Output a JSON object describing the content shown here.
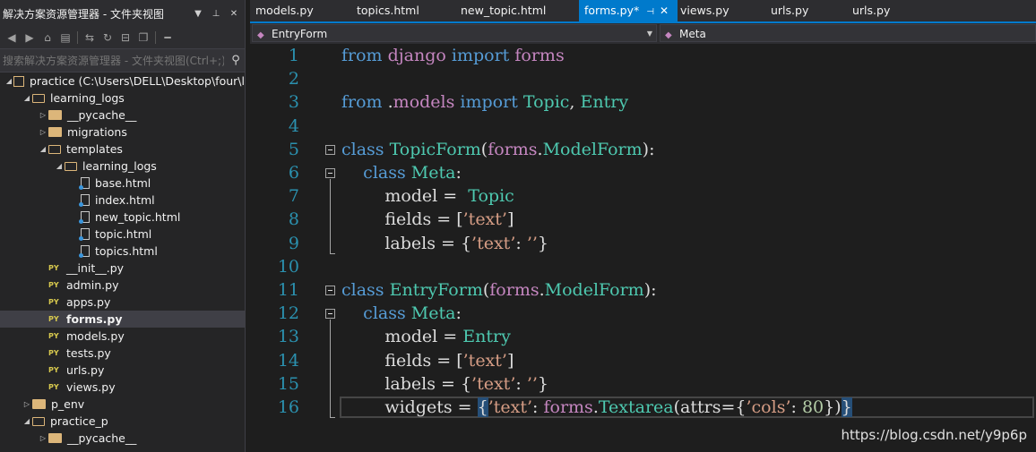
{
  "solution_explorer": {
    "title": "解决方案资源管理器 - 文件夹视图",
    "search_placeholder": "搜索解决方案资源管理器 - 文件夹视图(Ctrl+;)",
    "tree": [
      {
        "label": "practice (C:\\Users\\DELL\\Desktop\\four\\l",
        "level": 0,
        "type": "project",
        "expanded": true
      },
      {
        "label": "learning_logs",
        "level": 1,
        "type": "folder",
        "expanded": true
      },
      {
        "label": "__pycache__",
        "level": 2,
        "type": "folder",
        "expanded": false
      },
      {
        "label": "migrations",
        "level": 2,
        "type": "folder",
        "expanded": false
      },
      {
        "label": "templates",
        "level": 2,
        "type": "folder",
        "expanded": true
      },
      {
        "label": "learning_logs",
        "level": 3,
        "type": "folder",
        "expanded": true
      },
      {
        "label": "base.html",
        "level": 4,
        "type": "html"
      },
      {
        "label": "index.html",
        "level": 4,
        "type": "html"
      },
      {
        "label": "new_topic.html",
        "level": 4,
        "type": "html"
      },
      {
        "label": "topic.html",
        "level": 4,
        "type": "html"
      },
      {
        "label": "topics.html",
        "level": 4,
        "type": "html"
      },
      {
        "label": "__init__.py",
        "level": 2,
        "type": "py"
      },
      {
        "label": "admin.py",
        "level": 2,
        "type": "py"
      },
      {
        "label": "apps.py",
        "level": 2,
        "type": "py"
      },
      {
        "label": "forms.py",
        "level": 2,
        "type": "py",
        "selected": true
      },
      {
        "label": "models.py",
        "level": 2,
        "type": "py"
      },
      {
        "label": "tests.py",
        "level": 2,
        "type": "py"
      },
      {
        "label": "urls.py",
        "level": 2,
        "type": "py"
      },
      {
        "label": "views.py",
        "level": 2,
        "type": "py"
      },
      {
        "label": "p_env",
        "level": 1,
        "type": "folder",
        "expanded": false
      },
      {
        "label": "practice_p",
        "level": 1,
        "type": "folder",
        "expanded": true
      },
      {
        "label": "__pycache__",
        "level": 2,
        "type": "folder",
        "expanded": false
      }
    ]
  },
  "tabs": [
    {
      "label": "models.py",
      "active": false
    },
    {
      "label": "topics.html",
      "active": false
    },
    {
      "label": "new_topic.html",
      "active": false
    },
    {
      "label": "forms.py*",
      "active": true
    },
    {
      "label": "views.py",
      "active": false
    },
    {
      "label": "urls.py",
      "active": false
    },
    {
      "label": "urls.py",
      "active": false
    }
  ],
  "navbar": {
    "class_combo": "EntryForm",
    "member_combo": "Meta"
  },
  "editor": {
    "line_numbers": [
      "1",
      "2",
      "3",
      "4",
      "5",
      "6",
      "7",
      "8",
      "9",
      "10",
      "11",
      "12",
      "13",
      "14",
      "15",
      "16"
    ],
    "lines": [
      [
        [
          "kw",
          "from"
        ],
        [
          "p",
          " "
        ],
        [
          "mod",
          "django"
        ],
        [
          "p",
          " "
        ],
        [
          "kw",
          "import"
        ],
        [
          "p",
          " "
        ],
        [
          "mod",
          "forms"
        ]
      ],
      [],
      [
        [
          "kw",
          "from"
        ],
        [
          "p",
          " ."
        ],
        [
          "mod",
          "models"
        ],
        [
          "p",
          " "
        ],
        [
          "kw",
          "import"
        ],
        [
          "p",
          " "
        ],
        [
          "cls",
          "Topic"
        ],
        [
          "p",
          ", "
        ],
        [
          "cls",
          "Entry"
        ]
      ],
      [],
      [
        [
          "kw",
          "class"
        ],
        [
          "p",
          " "
        ],
        [
          "cls",
          "TopicForm"
        ],
        [
          "p",
          "("
        ],
        [
          "mod",
          "forms"
        ],
        [
          "p",
          "."
        ],
        [
          "cls",
          "ModelForm"
        ],
        [
          "p",
          "):"
        ]
      ],
      [
        [
          "p",
          "    "
        ],
        [
          "kw",
          "class"
        ],
        [
          "p",
          " "
        ],
        [
          "cls",
          "Meta"
        ],
        [
          "p",
          ":"
        ]
      ],
      [
        [
          "p",
          "        model =  "
        ],
        [
          "cls",
          "Topic"
        ]
      ],
      [
        [
          "p",
          "        fields = ["
        ],
        [
          "str",
          "’text’"
        ],
        [
          "p",
          "]"
        ]
      ],
      [
        [
          "p",
          "        labels = {"
        ],
        [
          "str",
          "’text’"
        ],
        [
          "p",
          ": "
        ],
        [
          "str",
          "’’"
        ],
        [
          "p",
          "}"
        ]
      ],
      [],
      [
        [
          "kw",
          "class"
        ],
        [
          "p",
          " "
        ],
        [
          "cls",
          "EntryForm"
        ],
        [
          "p",
          "("
        ],
        [
          "mod",
          "forms"
        ],
        [
          "p",
          "."
        ],
        [
          "cls",
          "ModelForm"
        ],
        [
          "p",
          "):"
        ]
      ],
      [
        [
          "p",
          "    "
        ],
        [
          "kw",
          "class"
        ],
        [
          "p",
          " "
        ],
        [
          "cls",
          "Meta"
        ],
        [
          "p",
          ":"
        ]
      ],
      [
        [
          "p",
          "        model = "
        ],
        [
          "cls",
          "Entry"
        ]
      ],
      [
        [
          "p",
          "        fields = ["
        ],
        [
          "str",
          "’text’"
        ],
        [
          "p",
          "]"
        ]
      ],
      [
        [
          "p",
          "        labels = {"
        ],
        [
          "str",
          "’text’"
        ],
        [
          "p",
          ": "
        ],
        [
          "str",
          "’’"
        ],
        [
          "p",
          "}"
        ]
      ],
      [
        [
          "p",
          "        widgets = "
        ],
        [
          "hl",
          "{"
        ],
        [
          "str",
          "’text’"
        ],
        [
          "p",
          ": "
        ],
        [
          "mod",
          "forms"
        ],
        [
          "p",
          "."
        ],
        [
          "cls",
          "Textarea"
        ],
        [
          "p",
          "(attrs={"
        ],
        [
          "str",
          "’cols’"
        ],
        [
          "p",
          ": "
        ],
        [
          "num",
          "80"
        ],
        [
          "p",
          "})"
        ],
        [
          "hl",
          "}"
        ]
      ]
    ]
  },
  "watermark": "https://blog.csdn.net/y9p6p",
  "colors": {
    "accent": "#007acc",
    "keyword": "#569cd6",
    "module": "#c586c0",
    "class": "#4ec9b0",
    "string": "#d69d85",
    "number": "#b5cea8",
    "line_number": "#2b91af"
  }
}
